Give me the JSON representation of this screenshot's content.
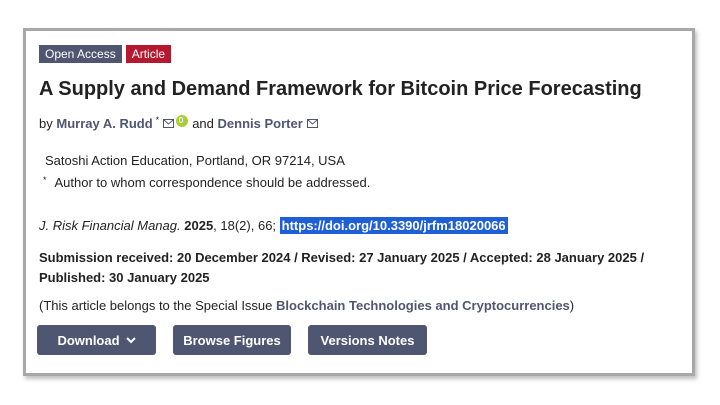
{
  "badges": {
    "open_access": "Open Access",
    "article": "Article"
  },
  "title": "A Supply and Demand Framework for Bitcoin Price Forecasting",
  "authors": {
    "by": "by",
    "author1": "Murray A. Rudd",
    "author1_mark": "*",
    "and": "and",
    "author2": "Dennis Porter"
  },
  "affiliation": "Satoshi Action Education, Portland, OR 97214, USA",
  "correspondence": {
    "mark": "*",
    "text": "Author to whom correspondence should be addressed."
  },
  "citation": {
    "journal": "J. Risk Financial Manag.",
    "year": "2025",
    "volume_issue": ", 18(2), 66; ",
    "doi": "https://doi.org/10.3390/jrfm18020066"
  },
  "dates": "Submission received: 20 December 2024 / Revised: 27 January 2025 / Accepted: 28 January 2025 / Published: 30 January 2025",
  "special_issue": {
    "prefix": "(This article belongs to the Special Issue ",
    "name": "Blockchain Technologies and Cryptocurrencies",
    "suffix": ")"
  },
  "buttons": {
    "download": "Download",
    "browse_figures": "Browse Figures",
    "versions_notes": "Versions Notes"
  },
  "colors": {
    "accent": "#4f5671",
    "article_badge": "#b5192f",
    "doi_highlight": "#1f5fd6",
    "orcid": "#a6ce39"
  }
}
